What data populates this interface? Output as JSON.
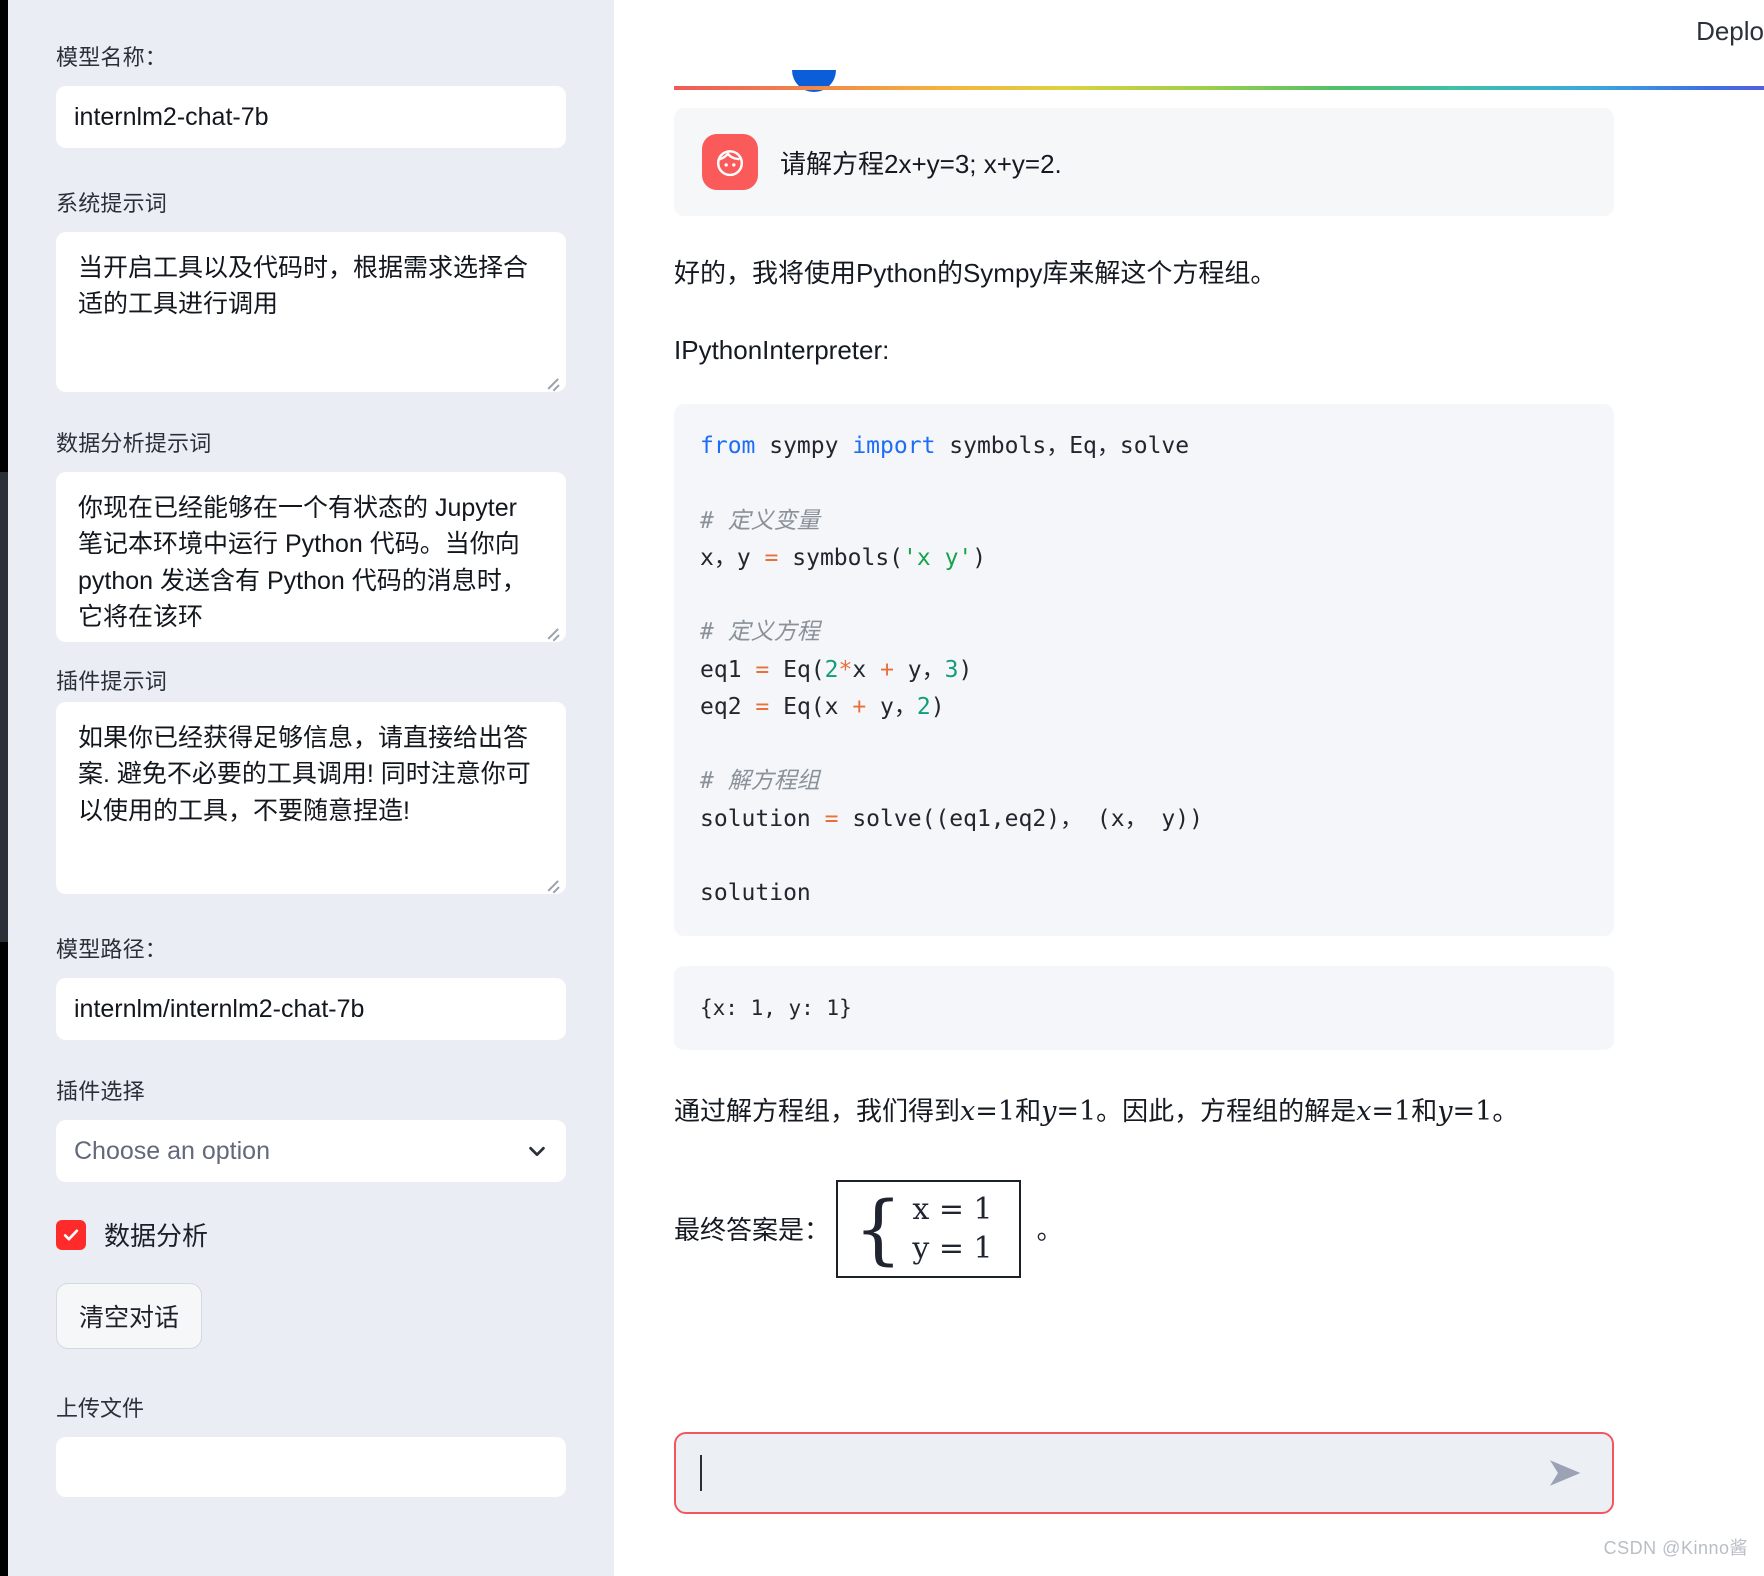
{
  "sidebar": {
    "model_name_label": "模型名称：",
    "model_name_value": "internlm2-chat-7b",
    "system_prompt_label": "系统提示词",
    "system_prompt_value": "当开启工具以及代码时，根据需求选择合适的工具进行调用",
    "data_analysis_prompt_label": "数据分析提示词",
    "data_analysis_prompt_value": "你现在已经能够在一个有状态的 Jupyter 笔记本环境中运行 Python 代码。当你向 python 发送含有 Python 代码的消息时，它将在该环",
    "plugin_prompt_label": "插件提示词",
    "plugin_prompt_value": "如果你已经获得足够信息，请直接给出答案. 避免不必要的工具调用! 同时注意你可以使用的工具，不要随意捏造!",
    "model_path_label": "模型路径：",
    "model_path_value": "internlm/internlm2-chat-7b",
    "plugin_select_label": "插件选择",
    "plugin_select_placeholder": "Choose an option",
    "chevron_icon": "chevron-down-icon",
    "data_analysis_checkbox_label": "数据分析",
    "data_analysis_checkbox_checked": true,
    "checkbox_color": "#ff2b2b",
    "clear_chat_button": "清空对话",
    "upload_file_label": "上传文件"
  },
  "header": {
    "deploy_label": "Deplo",
    "blue_badge_icon": "blue-circle-badge"
  },
  "chat": {
    "user_avatar_icon": "user-face-avatar-icon",
    "user_avatar_color": "#fb5a5a",
    "user_message": "请解方程2x+y=3; x+y=2.",
    "assistant_intro": "好的，我将使用Python的Sympy库来解这个方程组。",
    "tool_name": "IPythonInterpreter:",
    "code": {
      "line1_kw1": "from",
      "line1_mid": " sympy ",
      "line1_kw2": "import",
      "line1_rest": " symbols，Eq，solve",
      "comment1": "# 定义变量",
      "line2_a": "x，y ",
      "line2_op": "=",
      "line2_b": " symbols(",
      "line2_str": "'x y'",
      "line2_c": ")",
      "comment2": "# 定义方程",
      "eq1_a": "eq1 ",
      "eq1_op": "=",
      "eq1_b": " Eq(",
      "eq1_n1": "2",
      "eq1_star": "*",
      "eq1_c": "x ",
      "eq1_plus": "+",
      "eq1_d": " y，",
      "eq1_n2": "3",
      "eq1_e": ")",
      "eq2_a": "eq2 ",
      "eq2_op": "=",
      "eq2_b": " Eq(x ",
      "eq2_plus": "+",
      "eq2_c": " y，",
      "eq2_n2": "2",
      "eq2_d": ")",
      "comment3": "# 解方程组",
      "sol_a": "solution ",
      "sol_op": "=",
      "sol_b": " solve((eq1,eq2)， (x， y))",
      "sol_last": "solution"
    },
    "output": "{x: 1, y: 1}",
    "conclusion": {
      "p1": "通过解方程组，我们得到",
      "m1_var": "x",
      "m1_eq": "=",
      "m1_val": "1",
      "p2": "和",
      "m2_var": "y",
      "m2_eq": "=",
      "m2_val": "1",
      "p3": "。因此，方程组的解是",
      "m3_var": "x",
      "m3_eq": "=",
      "m3_val": "1",
      "p4": "和",
      "m4_var": "y",
      "m4_eq": "=",
      "m4_val": "1",
      "p5": "。"
    },
    "final": {
      "label": "最终答案是：",
      "brace": "{",
      "line1": "x = 1",
      "line2": "y = 1",
      "period": "。"
    }
  },
  "composer": {
    "value": "",
    "send_icon": "send-arrow-icon",
    "border_color": "#f2575d"
  },
  "watermark": "CSDN @Kinno酱"
}
